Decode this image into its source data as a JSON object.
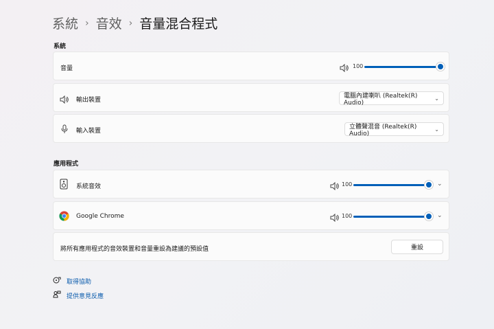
{
  "breadcrumb": {
    "level1": "系統",
    "level2": "音效",
    "current": "音量混合程式",
    "sep": "›"
  },
  "system": {
    "section_title": "系統",
    "volume": {
      "label": "音量",
      "value": "100",
      "level": 1.0
    },
    "output": {
      "label": "輸出裝置",
      "selected": "電腦內建喇叭 (Realtek(R) Audio)"
    },
    "input": {
      "label": "輸入裝置",
      "selected": "立體聲混音 (Realtek(R) Audio)"
    }
  },
  "apps": {
    "section_title": "應用程式",
    "items": [
      {
        "label": "系統音效",
        "value": "100",
        "level": 1.0
      },
      {
        "label": "Google Chrome",
        "value": "100",
        "level": 1.0
      }
    ],
    "reset": {
      "label": "將所有應用程式的音效裝置和音量重設為建議的預設值",
      "button": "重設"
    }
  },
  "links": {
    "help": "取得協助",
    "feedback": "提供意見反應"
  },
  "colors": {
    "accent": "#005fb8"
  }
}
